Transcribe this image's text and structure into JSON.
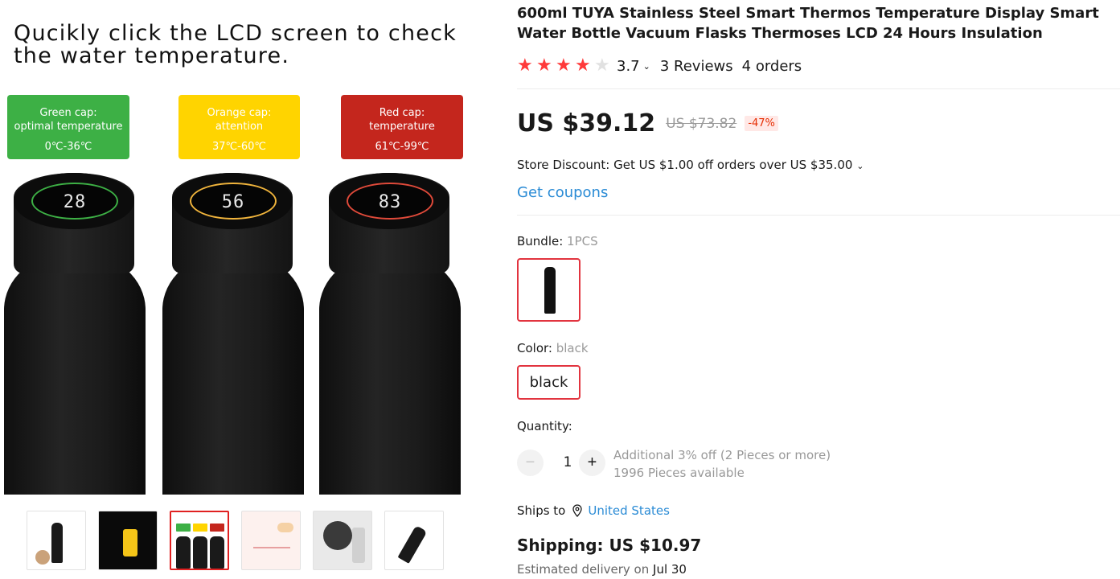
{
  "gallery": {
    "banner": "Qucikly click the LCD screen to check the water temperature.",
    "caps": [
      {
        "line1": "Green cap:",
        "line2": "optimal temperature",
        "range": "0℃-36℃",
        "color": "#3db045"
      },
      {
        "line1": "Orange cap:",
        "line2": "attention",
        "range": "37℃-60℃",
        "color": "#ffd400"
      },
      {
        "line1": "Red cap:",
        "line2": "temperature",
        "range": "61℃-99℃",
        "color": "#c4261d"
      }
    ],
    "bottle_readings": [
      "28",
      "56",
      "83"
    ],
    "active_thumbnail": 2,
    "thumbnail_count": 7
  },
  "product": {
    "title": "600ml TUYA Stainless Steel Smart Thermos Temperature Display Smart Water Bottle Vacuum Flasks Thermoses LCD 24 Hours Insulation",
    "rating": {
      "value": "3.7",
      "stars": 4,
      "max_stars": 5,
      "reviews": "3 Reviews",
      "orders": "4 orders"
    },
    "price": "US $39.12",
    "old_price": "US $73.82",
    "discount": "-47%",
    "store_discount": "Store Discount: Get US $1.00 off orders over US $35.00",
    "coupons_link": "Get coupons",
    "bundle": {
      "label": "Bundle: ",
      "value": "1PCS"
    },
    "color": {
      "label": "Color: ",
      "value": "black",
      "option": "black"
    },
    "quantity": {
      "label": "Quantity:",
      "value": "1",
      "minus": "−",
      "plus": "+",
      "note_line1": "Additional 3% off (2 Pieces or more)",
      "note_line2": "1996 Pieces available"
    },
    "ships_to": {
      "label": "Ships to",
      "country": "United States"
    },
    "shipping": "Shipping: US $10.97",
    "delivery": {
      "prefix": "Estimated delivery on",
      "date": "Jul 30"
    }
  },
  "colors": {
    "accent_red": "#e2343f",
    "star": "#ff3a3a",
    "link": "#2a8bd5"
  }
}
